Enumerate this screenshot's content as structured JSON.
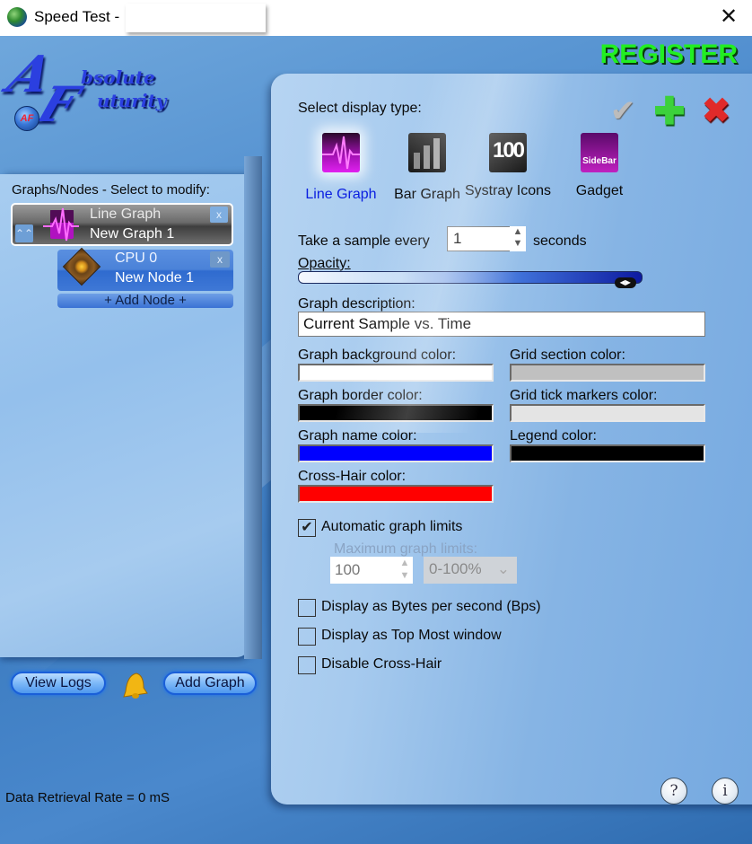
{
  "window": {
    "title": "Speed Test -",
    "close_glyph": "✕"
  },
  "brand": {
    "logo_line1_initial": "A",
    "logo_line1_word": "bsolute",
    "logo_line2_initial": "F",
    "logo_line2_word": "uturity",
    "badge_text": "AF",
    "register_label": "REGISTER"
  },
  "left_panel": {
    "heading": "Graphs/Nodes - Select to modify:",
    "graphs": [
      {
        "type": "Line Graph",
        "name": "New Graph 1",
        "expand_glyph": "⌃⌃",
        "remove_glyph": "x",
        "nodes": [
          {
            "source": "CPU 0",
            "name": "New Node 1",
            "remove_glyph": "x"
          }
        ]
      }
    ],
    "add_node_label": "+ Add Node +"
  },
  "bottom_buttons": {
    "view_logs": "View Logs",
    "add_graph": "Add Graph"
  },
  "status": {
    "text": "Data Retrieval Rate = 0 mS"
  },
  "help": {
    "help_glyph": "?",
    "info_glyph": "i"
  },
  "editor": {
    "select_display_label": "Select display type:",
    "toolbar": {
      "apply_glyph": "✔",
      "add_glyph": "✚",
      "delete_glyph": "✖"
    },
    "display_types": [
      {
        "label": "Line Graph",
        "selected": true,
        "icon": "line-graph-icon"
      },
      {
        "label": "Bar Graph",
        "selected": false,
        "icon": "bar-graph-icon"
      },
      {
        "label": "Systray Icons",
        "selected": false,
        "icon": "systray-icon",
        "icon_text": "100"
      },
      {
        "label": "Gadget",
        "selected": false,
        "icon": "gadget-icon",
        "icon_text": "SideBar"
      }
    ],
    "sample": {
      "prefix": "Take a sample every",
      "value": "1",
      "suffix": "seconds"
    },
    "opacity": {
      "label": "Opacity:",
      "value_fraction": 0.98
    },
    "description": {
      "label": "Graph description:",
      "value": "Current Sample vs. Time"
    },
    "colors": {
      "graph_background": {
        "label": "Graph background color:",
        "value": "#ffffff"
      },
      "grid_section": {
        "label": "Grid section color:",
        "value": "#c0c0c0"
      },
      "graph_border": {
        "label": "Graph border color:",
        "value": "#000000"
      },
      "grid_tick_markers": {
        "label": "Grid tick markers color:",
        "value": "#e4e4e4"
      },
      "graph_name": {
        "label": "Graph name color:",
        "value": "#0000ff"
      },
      "legend": {
        "label": "Legend color:",
        "value": "#000000"
      },
      "cross_hair": {
        "label": "Cross-Hair color:",
        "value": "#ff0000"
      }
    },
    "auto_limits": {
      "label": "Automatic graph limits",
      "checked": true,
      "max_label": "Maximum graph limits:",
      "max_value": "100",
      "range_selected": "0-100%"
    },
    "options": [
      {
        "label": "Display as Bytes per second (Bps)",
        "checked": false
      },
      {
        "label": "Display as Top Most window",
        "checked": false
      },
      {
        "label": "Disable Cross-Hair",
        "checked": false
      }
    ]
  }
}
